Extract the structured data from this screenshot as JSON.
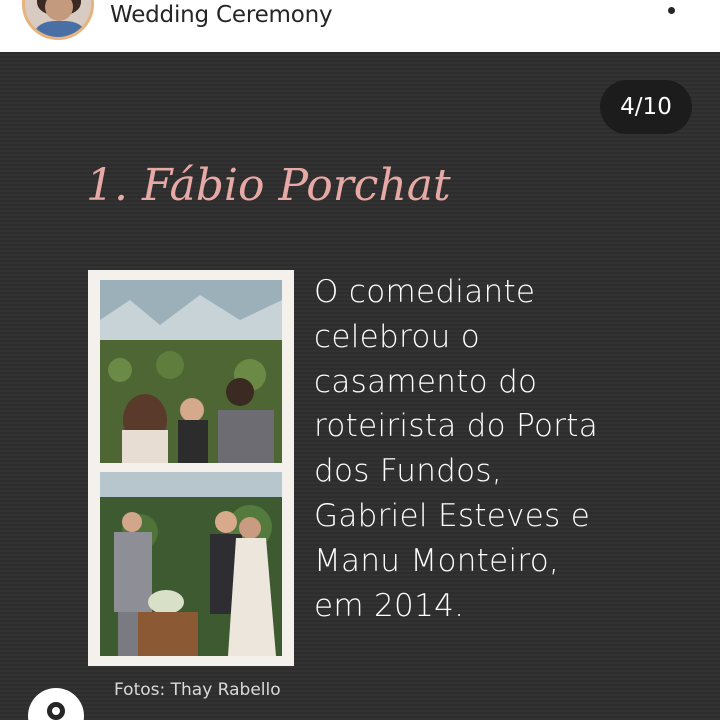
{
  "header": {
    "title": "Wedding Ceremony",
    "avatar_icon": "profile-avatar",
    "more_icon": "more-options-icon"
  },
  "slide": {
    "counter": "4/10",
    "title": "1. Fábio Porchat",
    "body_lines": [
      "O comediante",
      "celebrou o",
      "casamento do",
      "roteirista do Porta",
      "dos Fundos,",
      "Gabriel Esteves e",
      "Manu Monteiro,",
      "em 2014."
    ],
    "credit": "Fotos: Thay Rabello"
  },
  "colors": {
    "background": "#2e2e2e",
    "title_pink": "#e7a9a6",
    "text": "#ffffff"
  }
}
